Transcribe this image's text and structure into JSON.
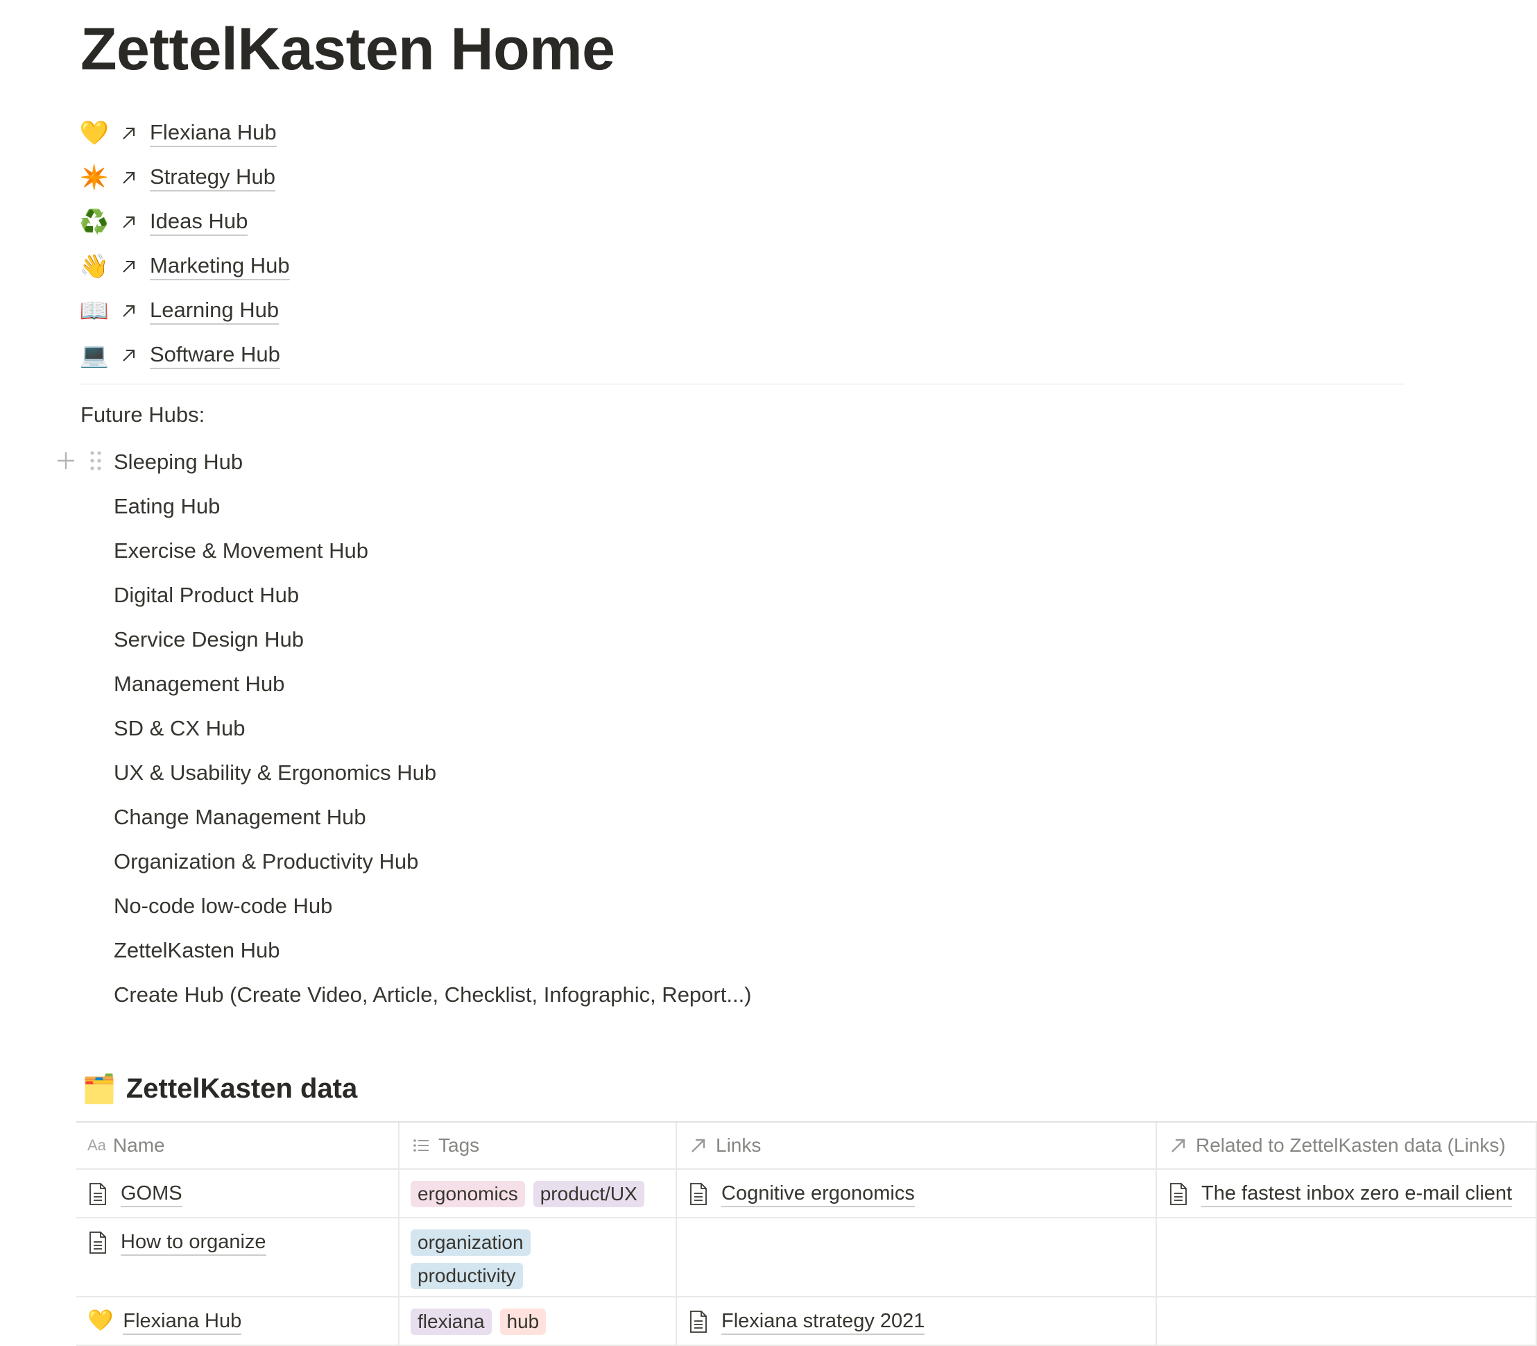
{
  "page": {
    "title": "ZettelKasten Home"
  },
  "hub_links": [
    {
      "emoji": "💛",
      "label": "Flexiana Hub"
    },
    {
      "emoji": "✴️",
      "label": "Strategy Hub"
    },
    {
      "emoji": "♻️",
      "label": "Ideas Hub"
    },
    {
      "emoji": "👋",
      "label": "Marketing Hub"
    },
    {
      "emoji": "📖",
      "label": "Learning Hub"
    },
    {
      "emoji": "💻",
      "label": "Software Hub"
    }
  ],
  "future": {
    "heading": "Future Hubs:",
    "items": [
      "Sleeping Hub",
      "Eating Hub",
      "Exercise & Movement Hub",
      "Digital Product Hub",
      "Service Design Hub",
      "Management Hub",
      "SD & CX Hub",
      "UX & Usability & Ergonomics Hub",
      "Change Management Hub",
      "Organization & Productivity Hub",
      "No-code low-code Hub",
      "ZettelKasten Hub",
      "Create Hub (Create Video, Article, Checklist, Infographic, Report...)"
    ]
  },
  "database": {
    "emoji": "🗂️",
    "title": "ZettelKasten data",
    "columns": {
      "name": {
        "icon_text": "Aa",
        "label": "Name"
      },
      "tags": {
        "icon": "list-icon",
        "label": "Tags"
      },
      "links": {
        "icon": "relation-arrow-icon",
        "label": "Links"
      },
      "related": {
        "icon": "relation-arrow-icon",
        "label": "Related to ZettelKasten data (Links)"
      }
    },
    "rows": [
      {
        "name": "GOMS",
        "tags": [
          {
            "label": "ergonomics",
            "color": "#f5e0e9"
          },
          {
            "label": "product/UX",
            "color": "#e8deee"
          }
        ],
        "links": "Cognitive ergonomics",
        "related": "The fastest inbox zero e-mail client"
      },
      {
        "name": "How to organize",
        "tags": [
          {
            "label": "organization",
            "color": "#d3e5ef"
          },
          {
            "label": "productivity",
            "color": "#d3e5ef"
          }
        ],
        "links": "",
        "related": ""
      },
      {
        "emoji": "💛",
        "name": "Flexiana Hub",
        "tags": [
          {
            "label": "flexiana",
            "color": "#e8deee"
          },
          {
            "label": "hub",
            "color": "#ffe2dd"
          }
        ],
        "links": "Flexiana strategy 2021",
        "related": ""
      }
    ]
  },
  "colors": {
    "text": "#37352f",
    "divider": "#e3e2e0",
    "muted": "#9b9a97"
  }
}
